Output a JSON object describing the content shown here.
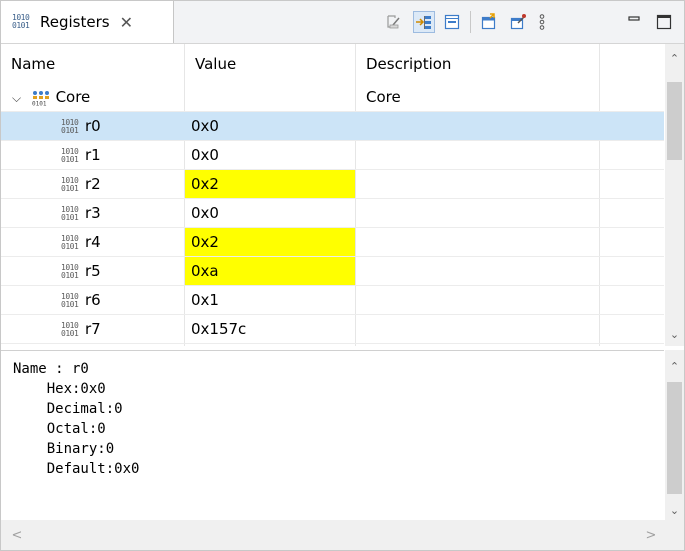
{
  "view": {
    "tab_title": "Registers",
    "tab_icon_text_top": "1010",
    "tab_icon_text_bottom": "0101",
    "close_glyph": "✕"
  },
  "toolbar": {
    "icons": [
      {
        "name": "clear-icon",
        "active": false
      },
      {
        "name": "toggle-layout-icon",
        "active": true
      },
      {
        "name": "collapse-all-icon",
        "active": false
      },
      {
        "name": "export-icon",
        "active": false
      },
      {
        "name": "pin-icon",
        "active": false
      },
      {
        "name": "view-menu-icon",
        "active": false
      },
      {
        "name": "minimize-icon",
        "active": false
      },
      {
        "name": "maximize-icon",
        "active": false
      }
    ]
  },
  "table": {
    "columns": [
      "Name",
      "Value",
      "Description"
    ],
    "group": {
      "name": "Core",
      "description": "Core",
      "expanded": true
    },
    "icon_top": "1010",
    "icon_bottom": "0101",
    "rows": [
      {
        "name": "r0",
        "value": "0x0",
        "selected": true,
        "changed": false
      },
      {
        "name": "r1",
        "value": "0x0",
        "selected": false,
        "changed": false
      },
      {
        "name": "r2",
        "value": "0x2",
        "selected": false,
        "changed": true
      },
      {
        "name": "r3",
        "value": "0x0",
        "selected": false,
        "changed": false
      },
      {
        "name": "r4",
        "value": "0x2",
        "selected": false,
        "changed": true
      },
      {
        "name": "r5",
        "value": "0xa",
        "selected": false,
        "changed": true
      },
      {
        "name": "r6",
        "value": "0x1",
        "selected": false,
        "changed": false
      },
      {
        "name": "r7",
        "value": "0x157c",
        "selected": false,
        "changed": false
      }
    ]
  },
  "details": {
    "lines": [
      "Name : r0",
      "    Hex:0x0",
      "    Decimal:0",
      "    Octal:0",
      "    Binary:0",
      "    Default:0x0"
    ]
  },
  "colors": {
    "selection": "#cce4f7",
    "changed_value": "#ffff00"
  }
}
